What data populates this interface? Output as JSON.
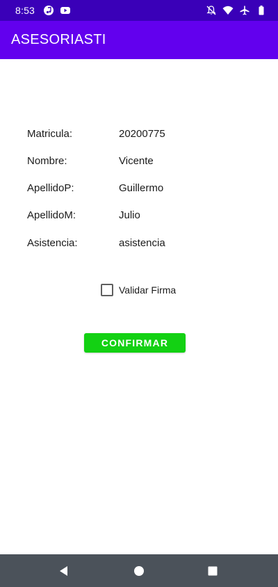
{
  "status_bar": {
    "time": "8:53",
    "left_icons": [
      "music-notification-icon",
      "youtube-notification-icon"
    ],
    "right_icons": [
      "notifications-off-icon",
      "wifi-icon",
      "airplane-mode-icon",
      "battery-icon"
    ]
  },
  "app_bar": {
    "title": "ASESORIASTI"
  },
  "details": {
    "rows": [
      {
        "label": "Matricula:",
        "value": "20200775"
      },
      {
        "label": "Nombre:",
        "value": "Vicente"
      },
      {
        "label": "ApellidoP:",
        "value": "Guillermo"
      },
      {
        "label": "ApellidoM:",
        "value": "Julio"
      },
      {
        "label": "Asistencia:",
        "value": "asistencia"
      }
    ]
  },
  "validate_signature": {
    "label": "Validar Firma",
    "checked": false
  },
  "confirm_button": {
    "label": "CONFIRMAR"
  },
  "colors": {
    "status_bar": "#3a00b8",
    "app_bar": "#6200ee",
    "confirm_button": "#13d113",
    "nav_bar": "#4b525a"
  },
  "nav_bar": {
    "buttons": [
      "back-icon",
      "home-icon",
      "recents-icon"
    ]
  }
}
